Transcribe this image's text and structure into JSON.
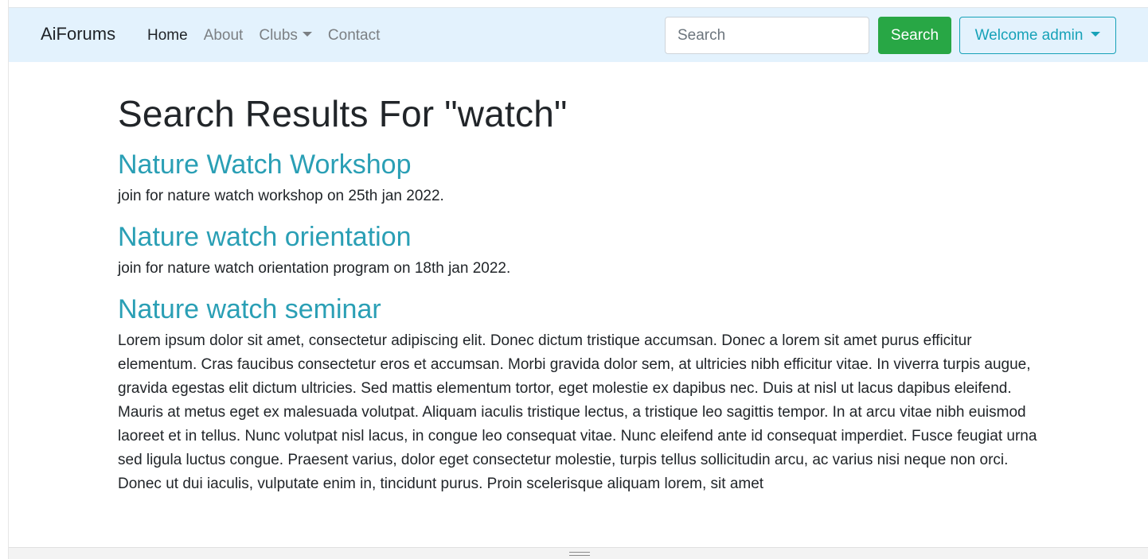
{
  "navbar": {
    "brand": "AiForums",
    "links": [
      {
        "label": "Home",
        "active": true
      },
      {
        "label": "About",
        "active": false
      },
      {
        "label": "Clubs",
        "active": false,
        "dropdown": true
      },
      {
        "label": "Contact",
        "active": false
      }
    ],
    "search_placeholder": "Search",
    "search_button": "Search",
    "user_menu": "Welcome admin"
  },
  "main": {
    "heading": "Search Results For \"watch\"",
    "results": [
      {
        "title": "Nature Watch Workshop",
        "description": "join for nature watch workshop on 25th jan 2022."
      },
      {
        "title": "Nature watch orientation",
        "description": "join for nature watch orientation program on 18th jan 2022."
      },
      {
        "title": "Nature watch seminar",
        "description": "Lorem ipsum dolor sit amet, consectetur adipiscing elit. Donec dictum tristique accumsan. Donec a lorem sit amet purus efficitur elementum. Cras faucibus consectetur eros et accumsan. Morbi gravida dolor sem, at ultricies nibh efficitur vitae. In viverra turpis augue, gravida egestas elit dictum ultricies. Sed mattis elementum tortor, eget molestie ex dapibus nec. Duis at nisl ut lacus dapibus eleifend. Mauris at metus eget ex malesuada volutpat. Aliquam iaculis tristique lectus, a tristique leo sagittis tempor. In at arcu vitae nibh euismod laoreet et in tellus. Nunc volutpat nisl lacus, in congue leo consequat vitae. Nunc eleifend ante id consequat imperdiet. Fusce feugiat urna sed ligula luctus congue. Praesent varius, dolor eget consectetur molestie, turpis tellus sollicitudin arcu, ac varius nisi neque non orci. Donec ut dui iaculis, vulputate enim in, tincidunt purus. Proin scelerisque aliquam lorem, sit amet"
      }
    ]
  },
  "colors": {
    "navbar_bg": "#e3f2fd",
    "link_accent": "#2a9fb5",
    "success": "#28a745",
    "info": "#17a2b8"
  },
  "icons": {
    "dropdown": "chevron-down-icon",
    "resize": "resize-grip-icon"
  }
}
